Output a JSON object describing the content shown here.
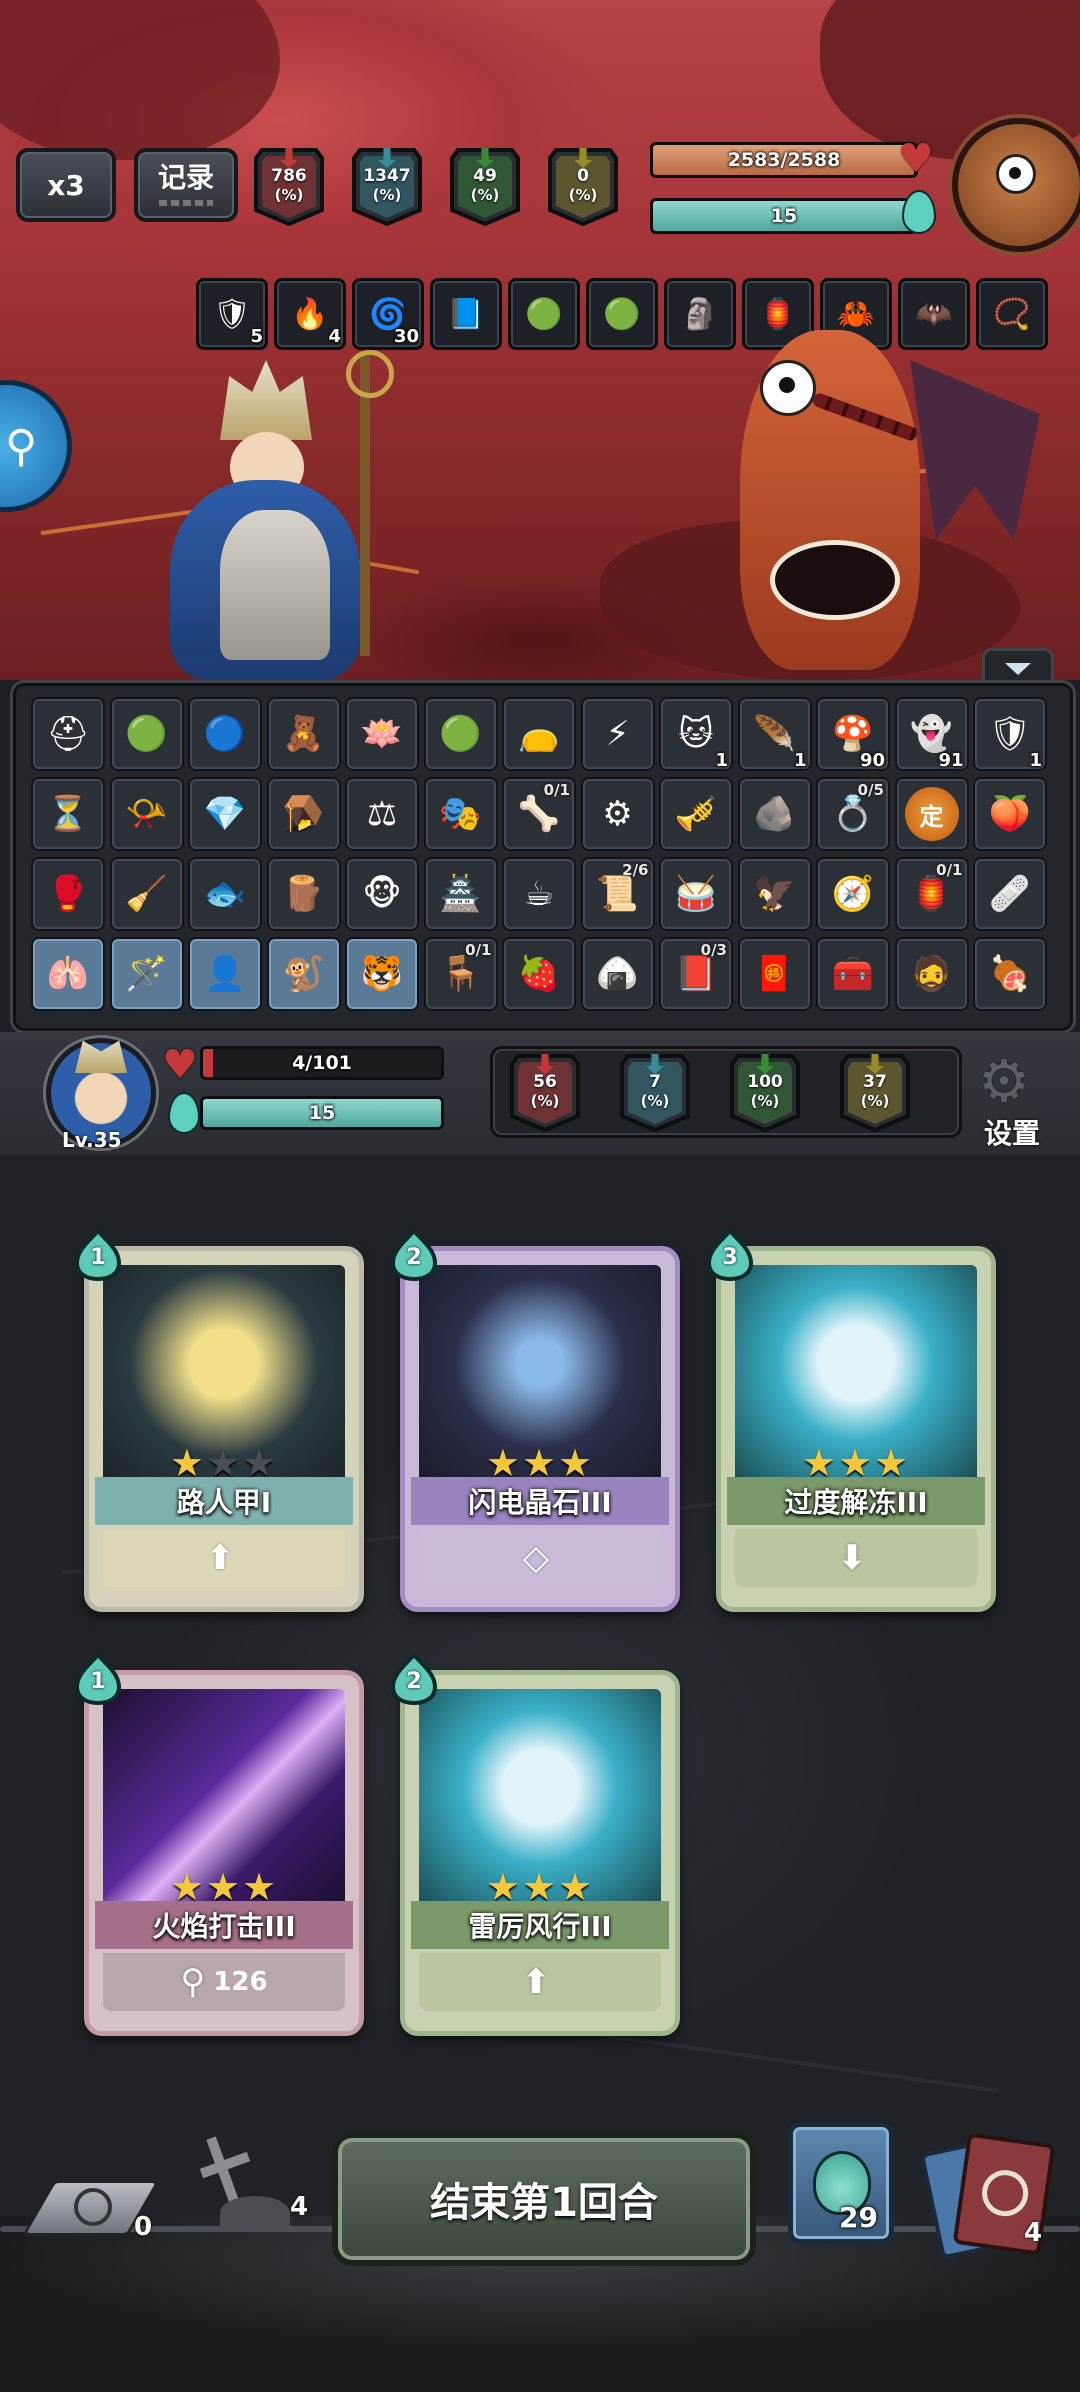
{
  "top_bar": {
    "speed_label": "x3",
    "record_label": "记录",
    "enemy_stats": [
      {
        "value": "786",
        "unit": "(%)",
        "color": "#c03a3a",
        "icon": "attack-sword-icon"
      },
      {
        "value": "1347",
        "unit": "(%)",
        "color": "#3a8a9a",
        "icon": "defense-shield-icon"
      },
      {
        "value": "49",
        "unit": "(%)",
        "color": "#3a8a3a",
        "icon": "resist-icon"
      },
      {
        "value": "0",
        "unit": "(%)",
        "color": "#9a8a2a",
        "icon": "speed-icon"
      }
    ],
    "enemy_hp_text": "2583/2588",
    "enemy_hp_fraction": 0.998,
    "enemy_energy_text": "15"
  },
  "enemy_buffs": [
    {
      "icon": "blue-shield-icon",
      "count": "5",
      "glyph": "🛡"
    },
    {
      "icon": "flame-icon",
      "count": "4",
      "glyph": "🔥"
    },
    {
      "icon": "spiral-icon",
      "count": "30",
      "glyph": "🌀"
    },
    {
      "icon": "book-icon",
      "count": "",
      "glyph": "📘"
    },
    {
      "icon": "green-gem-icon",
      "count": "",
      "glyph": "🟢"
    },
    {
      "icon": "green-gem-icon",
      "count": "",
      "glyph": "🟢"
    },
    {
      "icon": "statue-icon",
      "count": "",
      "glyph": "🗿"
    },
    {
      "icon": "fire-bowl-icon",
      "count": "",
      "glyph": "🏮"
    },
    {
      "icon": "claw-icon",
      "count": "",
      "glyph": "🦀"
    },
    {
      "icon": "bat-wing-icon",
      "count": "",
      "glyph": "🦇"
    },
    {
      "icon": "bead-necklace-icon",
      "count": "",
      "glyph": "📿"
    }
  ],
  "relics": [
    [
      {
        "icon": "helmet-icon",
        "glyph": "⛑",
        "count": "",
        "frac": "",
        "blue": false
      },
      {
        "icon": "green-gem-icon",
        "glyph": "🟢",
        "count": "",
        "frac": "",
        "blue": false
      },
      {
        "icon": "blue-orb-icon",
        "glyph": "🔵",
        "count": "",
        "frac": "",
        "blue": false
      },
      {
        "icon": "teddy-bear-icon",
        "glyph": "🧸",
        "count": "",
        "frac": "",
        "blue": false
      },
      {
        "icon": "lotus-icon",
        "glyph": "🪷",
        "count": "",
        "frac": "",
        "blue": false
      },
      {
        "icon": "green-gem-icon",
        "glyph": "🟢",
        "count": "",
        "frac": "",
        "blue": false
      },
      {
        "icon": "potion-bag-icon",
        "glyph": "👝",
        "count": "",
        "frac": "",
        "blue": false
      },
      {
        "icon": "lightning-icon",
        "glyph": "⚡",
        "count": "",
        "frac": "",
        "blue": false
      },
      {
        "icon": "cat-icon",
        "glyph": "🐱",
        "count": "1",
        "frac": "",
        "blue": false
      },
      {
        "icon": "feather-icon",
        "glyph": "🪶",
        "count": "1",
        "frac": "",
        "blue": false
      },
      {
        "icon": "mushroom-icon",
        "glyph": "🍄",
        "count": "90",
        "frac": "",
        "blue": false
      },
      {
        "icon": "ice-spirit-icon",
        "glyph": "👻",
        "count": "91",
        "frac": "",
        "blue": false
      },
      {
        "icon": "blue-shield-icon",
        "glyph": "🛡",
        "count": "1",
        "frac": "",
        "blue": false
      }
    ],
    [
      {
        "icon": "hourglass-icon",
        "glyph": "⏳",
        "count": "",
        "frac": "",
        "blue": false
      },
      {
        "icon": "red-horn-icon",
        "glyph": "📯",
        "count": "",
        "frac": "",
        "blue": false
      },
      {
        "icon": "ice-crystal-icon",
        "glyph": "💎",
        "count": "",
        "frac": "",
        "blue": false
      },
      {
        "icon": "trap-icon",
        "glyph": "🪤",
        "count": "",
        "frac": "",
        "blue": false
      },
      {
        "icon": "scales-icon",
        "glyph": "⚖",
        "count": "",
        "frac": "",
        "blue": false
      },
      {
        "icon": "mask-icon",
        "glyph": "🎭",
        "count": "",
        "frac": "",
        "blue": false
      },
      {
        "icon": "bone-claw-icon",
        "glyph": "🦴",
        "count": "",
        "frac": "0/1",
        "blue": false
      },
      {
        "icon": "gear-orb-icon",
        "glyph": "⚙",
        "count": "",
        "frac": "",
        "blue": false
      },
      {
        "icon": "flute-icon",
        "glyph": "🎺",
        "count": "",
        "frac": "",
        "blue": false
      },
      {
        "icon": "stone-icon",
        "glyph": "🪨",
        "count": "",
        "frac": "",
        "blue": false
      },
      {
        "icon": "ring-icon",
        "glyph": "💍",
        "count": "",
        "frac": "0/5",
        "blue": false
      },
      {
        "icon": "seal-icon",
        "glyph": "定",
        "count": "",
        "frac": "",
        "blue": false
      },
      {
        "icon": "peach-icon",
        "glyph": "🍑",
        "count": "",
        "frac": "",
        "blue": false
      }
    ],
    [
      {
        "icon": "boxing-glove-icon",
        "glyph": "🥊",
        "count": "",
        "frac": "",
        "blue": false
      },
      {
        "icon": "broom-icon",
        "glyph": "🧹",
        "count": "",
        "frac": "",
        "blue": false
      },
      {
        "icon": "fish-icon",
        "glyph": "🐟",
        "count": "",
        "frac": "",
        "blue": false
      },
      {
        "icon": "log-icon",
        "glyph": "🪵",
        "count": "",
        "frac": "",
        "blue": false
      },
      {
        "icon": "monkey-icon",
        "glyph": "🐵",
        "count": "",
        "frac": "",
        "blue": false
      },
      {
        "icon": "tower-icon",
        "glyph": "🏯",
        "count": "",
        "frac": "",
        "blue": false
      },
      {
        "icon": "teacup-icon",
        "glyph": "☕",
        "count": "",
        "frac": "",
        "blue": false
      },
      {
        "icon": "scroll-icon",
        "glyph": "📜",
        "count": "",
        "frac": "2/6",
        "blue": false
      },
      {
        "icon": "drum-icon",
        "glyph": "🥁",
        "count": "",
        "frac": "",
        "blue": false
      },
      {
        "icon": "claw-icon",
        "glyph": "🦅",
        "count": "",
        "frac": "",
        "blue": false
      },
      {
        "icon": "compass-icon",
        "glyph": "🧭",
        "count": "",
        "frac": "",
        "blue": false
      },
      {
        "icon": "lantern-icon",
        "glyph": "🏮",
        "count": "",
        "frac": "0/1",
        "blue": false
      },
      {
        "icon": "bandage-icon",
        "glyph": "🩹",
        "count": "",
        "frac": "",
        "blue": false
      }
    ],
    [
      {
        "icon": "lungs-icon",
        "glyph": "🫁",
        "count": "",
        "frac": "",
        "blue": true
      },
      {
        "icon": "wand-icon",
        "glyph": "🪄",
        "count": "",
        "frac": "",
        "blue": true
      },
      {
        "icon": "spirit-icon",
        "glyph": "👤",
        "count": "",
        "frac": "",
        "blue": true
      },
      {
        "icon": "monkey-king-icon",
        "glyph": "🐒",
        "count": "",
        "frac": "",
        "blue": true
      },
      {
        "icon": "tiger-icon",
        "glyph": "🐯",
        "count": "",
        "frac": "",
        "blue": true
      },
      {
        "icon": "throne-icon",
        "glyph": "🪑",
        "count": "",
        "frac": "0/1",
        "blue": false
      },
      {
        "icon": "strawberry-icon",
        "glyph": "🍓",
        "count": "",
        "frac": "",
        "blue": false
      },
      {
        "icon": "rice-ball-icon",
        "glyph": "🍙",
        "count": "",
        "frac": "",
        "blue": false
      },
      {
        "icon": "spellbook-icon",
        "glyph": "📕",
        "count": "",
        "frac": "0/3",
        "blue": false
      },
      {
        "icon": "talisman-icon",
        "glyph": "🧧",
        "count": "",
        "frac": "",
        "blue": false
      },
      {
        "icon": "treasure-box-icon",
        "glyph": "🧰",
        "count": "",
        "frac": "",
        "blue": false
      },
      {
        "icon": "monk-icon",
        "glyph": "🧔",
        "count": "",
        "frac": "",
        "blue": false
      },
      {
        "icon": "meat-icon",
        "glyph": "🍖",
        "count": "",
        "frac": "",
        "blue": false
      }
    ]
  ],
  "player": {
    "level": "Lv.35",
    "hp_text": "4/101",
    "hp_fraction": 0.04,
    "energy_text": "15",
    "stats": [
      {
        "value": "56",
        "unit": "(%)",
        "color": "#c03a3a",
        "icon": "attack-sword-icon"
      },
      {
        "value": "7",
        "unit": "(%)",
        "color": "#3a8a9a",
        "icon": "defense-shield-icon"
      },
      {
        "value": "100",
        "unit": "(%)",
        "color": "#3a8a3a",
        "icon": "resist-icon"
      },
      {
        "value": "37",
        "unit": "(%)",
        "color": "#9a8a2a",
        "icon": "speed-icon"
      }
    ],
    "settings_label": "设置"
  },
  "hand": [
    {
      "cost": "1",
      "name": "路人甲I",
      "stars": 1,
      "theme": "plain",
      "foot": "",
      "foot_icon": "upgrade-arrow-icon"
    },
    {
      "cost": "2",
      "name": "闪电晶石III",
      "stars": 3,
      "theme": "purple",
      "foot": "",
      "foot_icon": "diamond-icon"
    },
    {
      "cost": "3",
      "name": "过度解冻III",
      "stars": 3,
      "theme": "green",
      "foot": "",
      "foot_icon": "down-arrow-icon"
    },
    {
      "cost": "1",
      "name": "火焰打击III",
      "stars": 3,
      "theme": "pink",
      "foot": "126",
      "foot_icon": "staff-icon"
    },
    {
      "cost": "2",
      "name": "雷厉风行III",
      "stars": 3,
      "theme": "green",
      "foot": "",
      "foot_icon": "upgrade-arrow-icon"
    }
  ],
  "bottom": {
    "discard_count": "0",
    "grave_count": "4",
    "end_turn_label": "结束第1回合",
    "draw_count": "29",
    "deck_count": "4"
  }
}
